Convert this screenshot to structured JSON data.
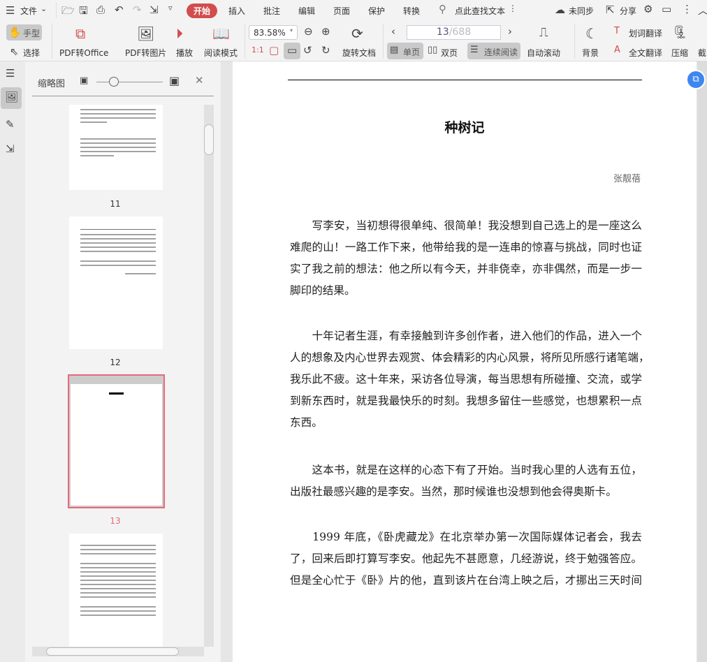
{
  "menu": {
    "file": "文件",
    "tabs": [
      "开始",
      "插入",
      "批注",
      "编辑",
      "页面",
      "保护",
      "转换"
    ],
    "active_tab": "开始",
    "search_placeholder": "点此查找文本",
    "sync": "未同步",
    "share": "分享"
  },
  "toolbar": {
    "hand": "手型",
    "select": "选择",
    "pdf_to_office": "PDF转Office",
    "pdf_to_image": "PDF转图片",
    "play": "播放",
    "read_mode": "阅读模式",
    "zoom": "83.58%",
    "rotate_doc": "旋转文档",
    "page_current": "13",
    "page_total": "/688",
    "single": "单页",
    "double": "双页",
    "continuous": "连续阅读",
    "auto_scroll": "自动滚动",
    "background": "背景",
    "word_translate": "划词翻译",
    "full_translate": "全文翻译",
    "compress": "压缩",
    "screenshot": "截"
  },
  "sidebar": {
    "title": "缩略图",
    "thumbnails": [
      {
        "label": "11"
      },
      {
        "label": "12"
      },
      {
        "label": "13",
        "selected": true
      }
    ],
    "accent": "#e8697a"
  },
  "document": {
    "title": "种树记",
    "author": "张靓蓓",
    "paragraphs": [
      [
        "　　写李安，当初想得很单纯、很简单！我没想到自己选上的是一座这么",
        "难爬的山！一路工作下来，他带给我的是一连串的惊喜与挑战，同时也证",
        "实了我之前的想法：他之所以有今天，并非侥幸，亦非偶然，而是一步一",
        "脚印的结果。"
      ],
      [
        "　　十年记者生涯，有幸接触到许多创作者，进入他们的作品，进入一个",
        "人的想象及内心世界去观赏、体会精彩的内心风景，将所见所感行诸笔端，",
        "我乐此不疲。这十年来，采访各位导演，每当思想有所碰撞、交流，或学",
        "到新东西时，就是我最快乐的时刻。我想多留住一些感觉，也想累积一点",
        "东西。"
      ],
      [
        "　　这本书，就是在这样的心态下有了开始。当时我心里的人选有五位，",
        "出版社最感兴趣的是李安。当然，那时候谁也没想到他会得奥斯卡。"
      ],
      [
        "　　1999 年底，《卧虎藏龙》在北京举办第一次国际媒体记者会，我去",
        "了，回来后即打算写李安。他起先不甚愿意，几经游说，终于勉强答应。",
        "但是全心忙于《卧》片的他，直到该片在台湾上映之后，才挪出三天时间"
      ]
    ]
  }
}
